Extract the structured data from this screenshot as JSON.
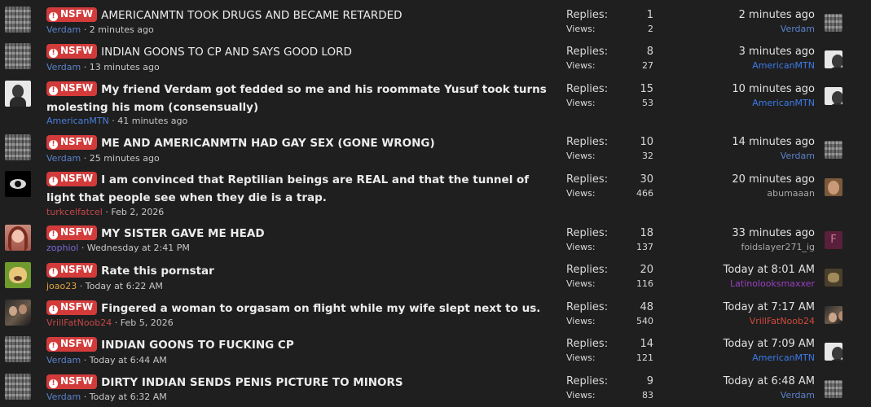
{
  "badge_label": "NSFW",
  "labels": {
    "replies": "Replies:",
    "views": "Views:"
  },
  "threads": [
    {
      "title": "AMERICANMTN TOOK DRUGS AND BECAME RETARDED",
      "author": "Verdam",
      "started": "· 2 minutes ago",
      "replies": "1",
      "views": "2",
      "last_time": "2 minutes ago",
      "last_user": "Verdam"
    },
    {
      "title": "INDIAN GOONS TO CP AND SAYS GOOD LORD",
      "author": "Verdam",
      "started": "· 13 minutes ago",
      "replies": "8",
      "views": "27",
      "last_time": "3 minutes ago",
      "last_user": "AmericanMTN"
    },
    {
      "title": "My friend Verdam got fedded so me and his roommate Yusuf took turns molesting his mom (consensually)",
      "author": "AmericanMTN",
      "started": "· 41 minutes ago",
      "replies": "15",
      "views": "53",
      "last_time": "10 minutes ago",
      "last_user": "AmericanMTN"
    },
    {
      "title": "ME AND AMERICANMTN HAD GAY SEX (GONE WRONG)",
      "author": "Verdam",
      "started": "· 25 minutes ago",
      "replies": "10",
      "views": "32",
      "last_time": "14 minutes ago",
      "last_user": "Verdam"
    },
    {
      "title": "I am convinced that Reptilian beings are REAL and that the tunnel of light that people see when they die is a trap.",
      "author": "turkcelfatcel",
      "started": "· Feb 2, 2026",
      "replies": "30",
      "views": "466",
      "last_time": "20 minutes ago",
      "last_user": "abumaaan"
    },
    {
      "title": "MY SISTER GAVE ME HEAD",
      "author": "zophiol",
      "started": "· Wednesday at 2:41 PM",
      "replies": "18",
      "views": "137",
      "last_time": "33 minutes ago",
      "last_user": "foidslayer271_ig",
      "last_avatar_letter": "F"
    },
    {
      "title": "Rate this pornstar",
      "author": "joao23",
      "started": "· Today at 6:22 AM",
      "replies": "20",
      "views": "116",
      "last_time": "Today at 8:01 AM",
      "last_user": "Latinolooksmaxxer"
    },
    {
      "title": "Fingered a woman to orgasam on flight while my wife slept next to us.",
      "author": "VrillFatNoob24",
      "started": "· Feb 5, 2026",
      "replies": "48",
      "views": "540",
      "last_time": "Today at 7:17 AM",
      "last_user": "VrillFatNoob24"
    },
    {
      "title": "INDIAN GOONS TO FUCKING CP",
      "author": "Verdam",
      "started": "· Today at 6:44 AM",
      "replies": "14",
      "views": "121",
      "last_time": "Today at 7:09 AM",
      "last_user": "AmericanMTN"
    },
    {
      "title": "DIRTY INDIAN SENDS PENIS PICTURE TO MINORS",
      "author": "Verdam",
      "started": "· Today at 6:32 AM",
      "replies": "9",
      "views": "83",
      "last_time": "Today at 6:48 AM",
      "last_user": "Verdam"
    }
  ],
  "colors": {
    "badge": "#d33b3b",
    "background": "#1f1f20",
    "link_blue": "#5b82c9"
  }
}
